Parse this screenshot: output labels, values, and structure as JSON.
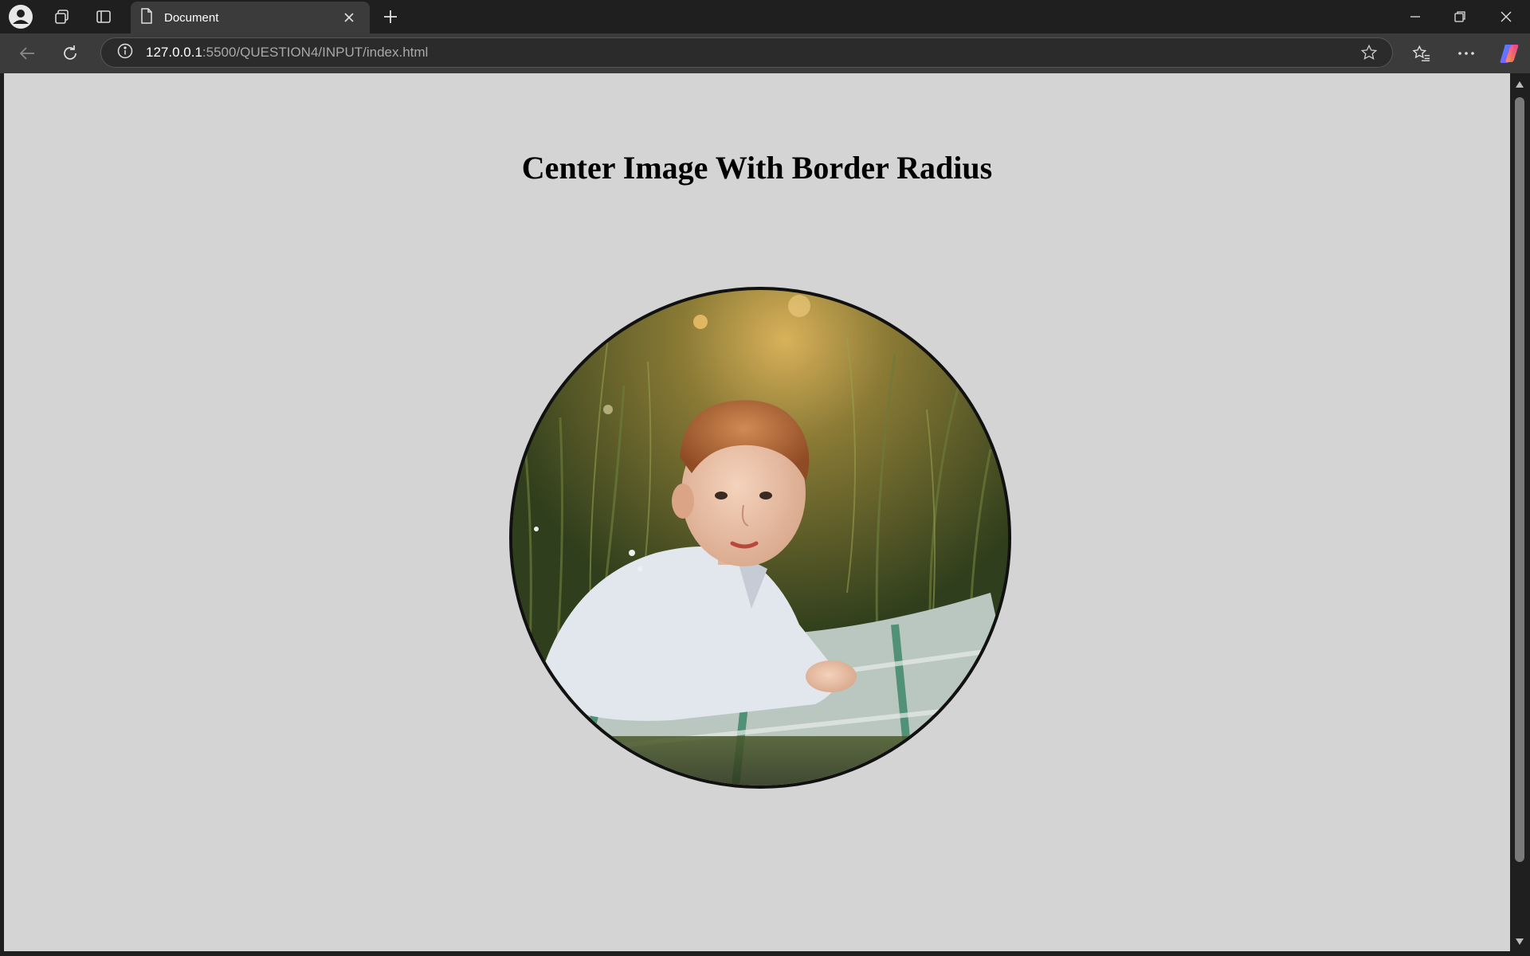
{
  "browser": {
    "tab": {
      "title": "Document",
      "icon": "document-icon"
    },
    "address": {
      "host": "127.0.0.1",
      "path": ":5500/QUESTION4/INPUT/index.html"
    }
  },
  "page": {
    "heading": "Center Image With Border Radius",
    "image_alt": "Child lying on a blanket in tall grass",
    "background": "#d4d4d4",
    "border_color": "#111111"
  },
  "icons": {
    "profile": "profile-avatar-icon",
    "workspaces": "workspaces-icon",
    "tab_actions": "vertical-tabs-icon",
    "new_tab": "plus-icon",
    "back": "back-arrow-icon",
    "refresh": "refresh-icon",
    "site_info": "info-icon",
    "favorite": "star-icon",
    "favorites": "favorites-icon",
    "more": "more-icon",
    "copilot": "copilot-icon"
  }
}
